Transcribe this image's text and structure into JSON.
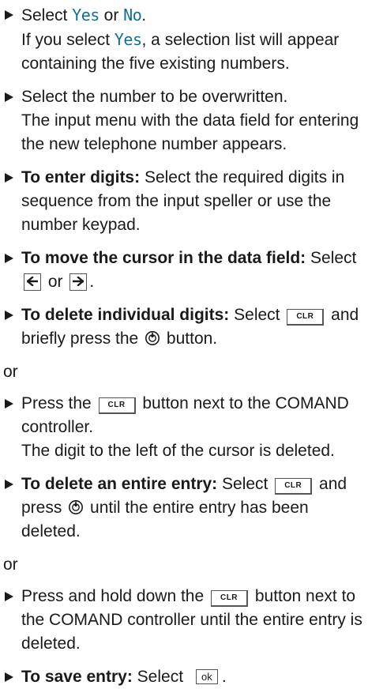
{
  "steps": [
    {
      "line1_a": "Select ",
      "yes": "Yes",
      "line1_b": " or ",
      "no": "No",
      "line1_c": ".",
      "line2_a": "If you select ",
      "line2_yes": "Yes",
      "line2_b": ", a selection list will appear containing the five existing numbers."
    },
    {
      "text": "Select the number to be overwritten.",
      "result": "The input menu with the data field for entering the new telephone number appears."
    },
    {
      "bold": "To enter digits:",
      "text": " Select the required digits in sequence from the input speller or use the number keypad."
    },
    {
      "bold": "To move the cursor in the data field:",
      "text_a": " Select ",
      "left_arrow": "🡐",
      "text_b": " or ",
      "right_arrow": "🡒",
      "text_c": "."
    },
    {
      "bold": "To delete individual digits:",
      "text_a": " Select ",
      "key": "CLR",
      "text_b": " and briefly press the ",
      "text_c": " button."
    },
    {
      "text_a": "Press the ",
      "key": "CLR",
      "text_b": " button next to the COMAND controller.",
      "result": "The digit to the left of the cursor is deleted."
    },
    {
      "bold": "To delete an entire entry:",
      "text_a": " Select ",
      "key": "CLR",
      "text_b": " and press ",
      "text_c": " until the entire entry has been deleted."
    },
    {
      "text_a": "Press and hold down the ",
      "key": "CLR",
      "text_b": " button next to the COMAND controller until the entire entry is deleted."
    },
    {
      "bold": "To save entry:",
      "text_a": " Select ",
      "key": "ok",
      "text_b": "."
    }
  ],
  "or_label": "or",
  "icons": {
    "controller_press": "controller-press-icon"
  },
  "colors": {
    "highlight": "#0e7190",
    "text": "#1a1a1a"
  }
}
